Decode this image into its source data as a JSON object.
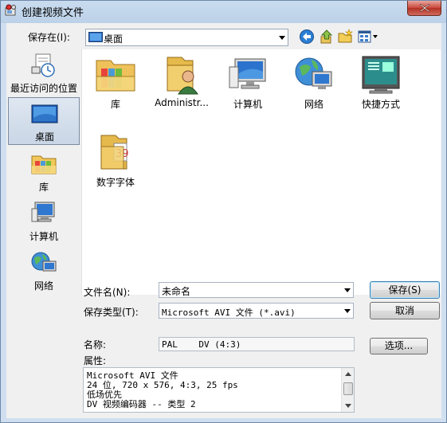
{
  "window": {
    "title": "创建视频文件"
  },
  "toolbar": {
    "save_in_label": "保存在(I):",
    "location": "桌面"
  },
  "places": [
    {
      "label": "最近访问的位置",
      "icon": "recent-places-icon",
      "selected": false
    },
    {
      "label": "桌面",
      "icon": "desktop-icon",
      "selected": true
    },
    {
      "label": "库",
      "icon": "libraries-icon",
      "selected": false
    },
    {
      "label": "计算机",
      "icon": "computer-icon",
      "selected": false
    },
    {
      "label": "网络",
      "icon": "network-icon",
      "selected": false
    }
  ],
  "files": [
    {
      "label": "库",
      "icon": "libraries-folder-icon"
    },
    {
      "label": "Administr...",
      "icon": "user-folder-icon"
    },
    {
      "label": "计算机",
      "icon": "computer-icon"
    },
    {
      "label": "网络",
      "icon": "network-icon"
    },
    {
      "label": "快捷方式",
      "icon": "shortcut-icon"
    },
    {
      "label": "数字字体",
      "icon": "font-folder-icon"
    }
  ],
  "form": {
    "filename_label": "文件名(N):",
    "filename_value": "未命名",
    "filetype_label": "保存类型(T):",
    "filetype_value": "Microsoft AVI 文件 (*.avi)",
    "name_label": "名称:",
    "name_value": "PAL    DV (4:3)",
    "properties_label": "属性:",
    "properties_lines": [
      "Microsoft AVI 文件",
      "24 位, 720 x 576, 4:3, 25 fps",
      "低场优先",
      "DV 视频编码器   -- 类型 2"
    ]
  },
  "buttons": {
    "save": "保存(S)",
    "cancel": "取消",
    "options": "选项..."
  }
}
